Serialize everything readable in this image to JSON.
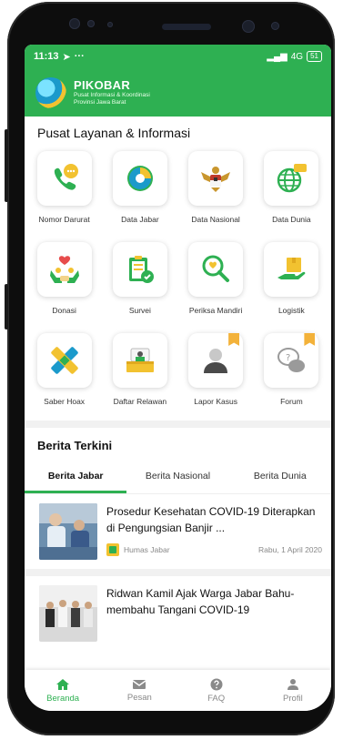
{
  "status": {
    "time": "11:13",
    "network": "4G",
    "battery": "51"
  },
  "header": {
    "brand": "PIKOBAR",
    "subtitle_line1": "Pusat Informasi & Koordinasi",
    "subtitle_line2": "Provinsi Jawa Barat"
  },
  "services": {
    "title": "Pusat Layanan & Informasi",
    "items": [
      {
        "label": "Nomor Darurat",
        "icon": "phone-chat-icon"
      },
      {
        "label": "Data Jabar",
        "icon": "data-jabar-icon"
      },
      {
        "label": "Data Nasional",
        "icon": "garuda-icon"
      },
      {
        "label": "Data Dunia",
        "icon": "globe-icon"
      },
      {
        "label": "Donasi",
        "icon": "donation-hands-icon"
      },
      {
        "label": "Survei",
        "icon": "survey-clipboard-icon"
      },
      {
        "label": "Periksa Mandiri",
        "icon": "magnifier-heart-icon"
      },
      {
        "label": "Logistik",
        "icon": "box-hand-icon"
      },
      {
        "label": "Saber Hoax",
        "icon": "hoax-cross-icon"
      },
      {
        "label": "Daftar Relawan",
        "icon": "volunteer-icon"
      },
      {
        "label": "Lapor Kasus",
        "icon": "report-person-icon"
      },
      {
        "label": "Forum",
        "icon": "forum-chat-icon"
      }
    ]
  },
  "news": {
    "title": "Berita Terkini",
    "tabs": [
      "Berita Jabar",
      "Berita Nasional",
      "Berita Dunia"
    ],
    "articles": [
      {
        "title": "Prosedur Kesehatan COVID-19 Diterapkan di Pengungsian Banjir ...",
        "source": "Humas Jabar",
        "date": "Rabu, 1 April 2020"
      },
      {
        "title": "Ridwan Kamil Ajak Warga Jabar Bahu-membahu Tangani COVID-19",
        "source": "",
        "date": ""
      }
    ]
  },
  "nav": {
    "items": [
      {
        "label": "Beranda",
        "icon": "home-icon"
      },
      {
        "label": "Pesan",
        "icon": "mail-icon"
      },
      {
        "label": "FAQ",
        "icon": "question-icon"
      },
      {
        "label": "Profil",
        "icon": "user-icon"
      }
    ]
  },
  "colors": {
    "brand_green": "#2eb052",
    "accent_yellow": "#f2c230"
  }
}
